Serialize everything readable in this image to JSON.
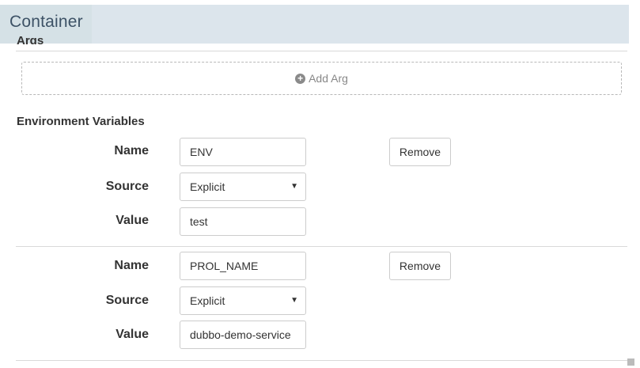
{
  "header": {
    "title": "Container"
  },
  "args": {
    "heading": "Args",
    "add_label": "Add Arg"
  },
  "env": {
    "title": "Environment Variables",
    "labels": {
      "name": "Name",
      "source": "Source",
      "value": "Value"
    },
    "remove_label": "Remove",
    "rows": [
      {
        "name": "ENV",
        "source": "Explicit",
        "value": "test"
      },
      {
        "name": "PROL_NAME",
        "source": "Explicit",
        "value": "dubbo-demo-service"
      }
    ]
  }
}
